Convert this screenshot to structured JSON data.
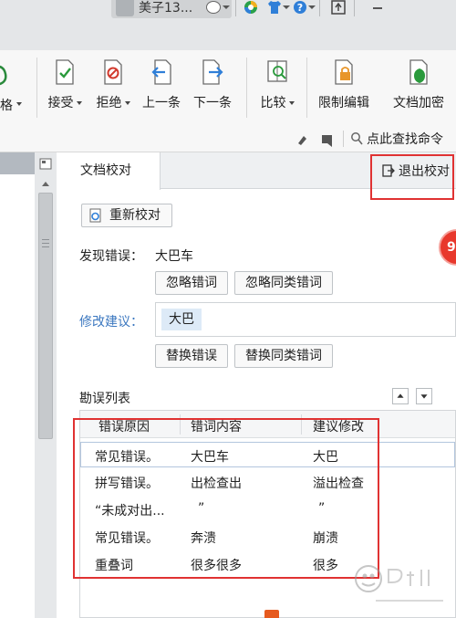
{
  "window": {
    "user_name": "美子13...",
    "title_icons": [
      "user-avatar-icon",
      "crown-icon",
      "browser-icon",
      "shirt-icon",
      "help-icon",
      "upload-icon",
      "minimize-icon"
    ]
  },
  "ribbon": {
    "partial_label": "格",
    "buttons": [
      {
        "label": "接受",
        "icon": "accept-doc-icon",
        "dropdown": true
      },
      {
        "label": "拒绝",
        "icon": "reject-doc-icon",
        "dropdown": true
      },
      {
        "label": "上一条",
        "icon": "previous-change-icon",
        "dropdown": false
      },
      {
        "label": "下一条",
        "icon": "next-change-icon",
        "dropdown": false
      },
      {
        "label": "比较",
        "icon": "compare-icon",
        "dropdown": true
      },
      {
        "label": "限制编辑",
        "icon": "lock-doc-icon",
        "dropdown": false
      },
      {
        "label": "文档加密",
        "icon": "encrypt-doc-icon",
        "dropdown": false
      }
    ],
    "search_command": "点此查找命令"
  },
  "pane": {
    "tab_label": "文档校对",
    "exit_label": "退出校对",
    "recheck_label": "重新校对",
    "found_error_label": "发现错误：",
    "found_error_value": "大巴车",
    "ignore_error": "忽略错词",
    "ignore_similar": "忽略同类错词",
    "suggest_label": "修改建议：",
    "suggest_value": "大巴",
    "replace_error": "替换错误",
    "replace_similar": "替换同类错词",
    "list_title": "勘误列表",
    "columns": [
      "错误原因",
      "错词内容",
      "建议修改"
    ],
    "rows": [
      {
        "reason": "常见错误。",
        "word": "大巴车",
        "fix": "大巴"
      },
      {
        "reason": "拼写错误。",
        "word": "出检查出",
        "fix": "溢出检查"
      },
      {
        "reason": "“未成对出...",
        "word": "”",
        "fix": "”"
      },
      {
        "reason": "常见错误。",
        "word": "奔溃",
        "fix": "崩溃"
      },
      {
        "reason": "重叠词",
        "word": "很多很多",
        "fix": "很多"
      }
    ]
  },
  "badge": {
    "text": "9"
  },
  "colors": {
    "highlight_red": "#e03232",
    "suggest_blue": "#3c78c0",
    "chip_bg": "#ddeaf7",
    "badge_red": "#e8382c"
  }
}
